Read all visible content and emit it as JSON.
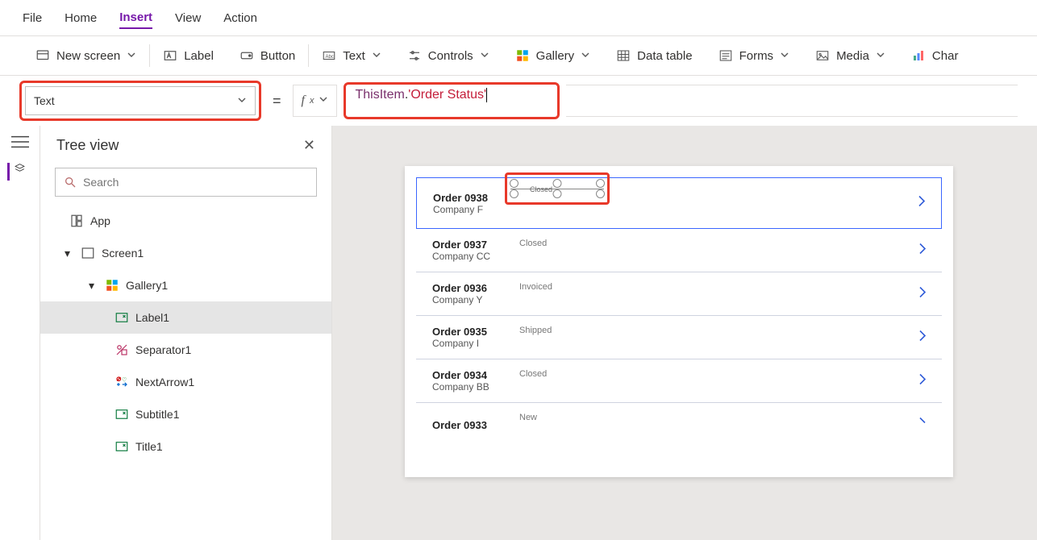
{
  "menu": {
    "file": "File",
    "home": "Home",
    "insert": "Insert",
    "view": "View",
    "action": "Action"
  },
  "ribbon": {
    "newscreen": "New screen",
    "label": "Label",
    "button": "Button",
    "text": "Text",
    "controls": "Controls",
    "gallery": "Gallery",
    "datatable": "Data table",
    "forms": "Forms",
    "media": "Media",
    "chart": "Char"
  },
  "property": {
    "selected": "Text"
  },
  "formula": {
    "prefix": "ThisItem",
    "dot": ".",
    "field": "'Order Status'"
  },
  "tree": {
    "title": "Tree view",
    "search_ph": "Search",
    "app": "App",
    "screen1": "Screen1",
    "gallery1": "Gallery1",
    "label1": "Label1",
    "separator1": "Separator1",
    "nextarrow1": "NextArrow1",
    "subtitle1": "Subtitle1",
    "title1": "Title1"
  },
  "gallery_rows": [
    {
      "title": "Order 0938",
      "subtitle": "Company F",
      "status": "Closed"
    },
    {
      "title": "Order 0937",
      "subtitle": "Company CC",
      "status": "Closed"
    },
    {
      "title": "Order 0936",
      "subtitle": "Company Y",
      "status": "Invoiced"
    },
    {
      "title": "Order 0935",
      "subtitle": "Company I",
      "status": "Shipped"
    },
    {
      "title": "Order 0934",
      "subtitle": "Company BB",
      "status": "Closed"
    },
    {
      "title": "Order 0933",
      "subtitle": "",
      "status": "New"
    }
  ]
}
